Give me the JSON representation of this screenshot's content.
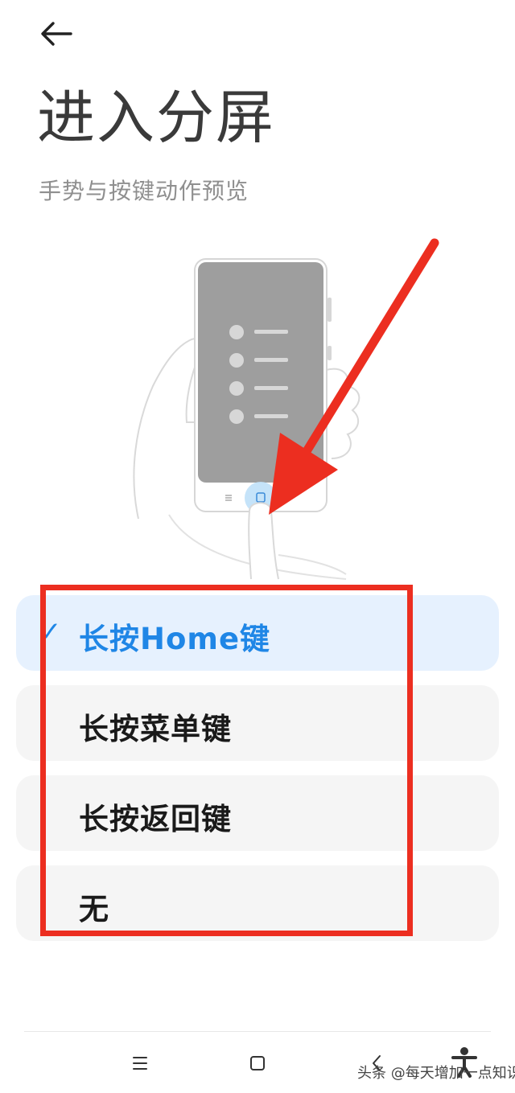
{
  "header": {
    "title": "进入分屏",
    "subtitle": "手势与按键动作预览",
    "back_icon": "back-arrow-icon"
  },
  "options": [
    {
      "label": "长按Home键",
      "selected": true
    },
    {
      "label": "长按菜单键",
      "selected": false
    },
    {
      "label": "长按返回键",
      "selected": false
    },
    {
      "label": "无",
      "selected": false
    }
  ],
  "check_mark": "✓",
  "colors": {
    "accent": "#1f86e6",
    "selected_bg": "#e6f1fe",
    "option_bg": "#f5f5f5",
    "annotation_red": "#ec2e20"
  },
  "nav_bar": {
    "menu_icon": "menu-icon",
    "home_icon": "home-icon",
    "back_icon": "back-chevron-icon"
  },
  "watermark": "头条 @每天增加一点知识"
}
